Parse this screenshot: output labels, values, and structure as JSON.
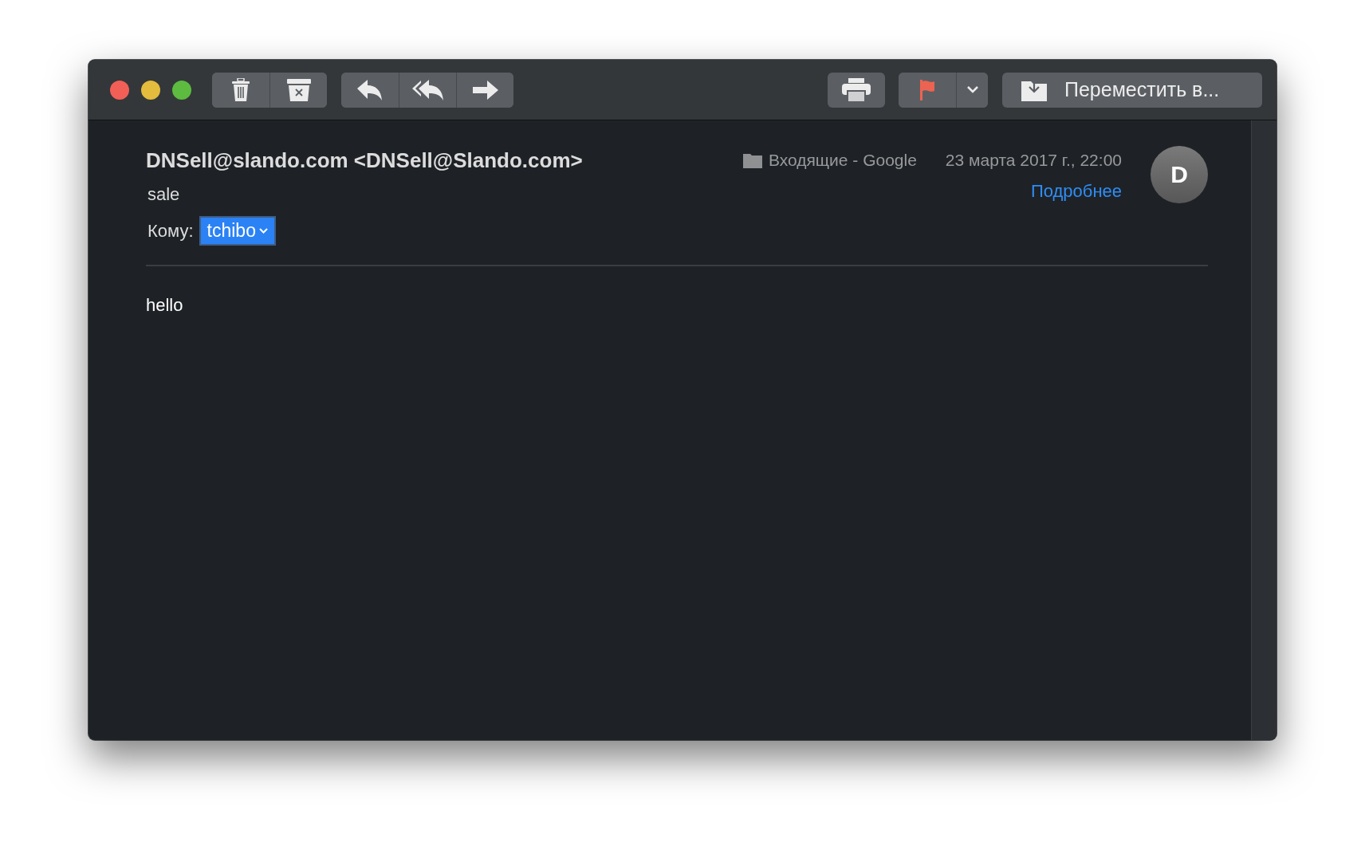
{
  "toolbar": {
    "move_button": {
      "label": "Переместить в..."
    }
  },
  "message": {
    "sender": "DNSell@slando.com <DNSell@Slando.com>",
    "subject": "sale",
    "to_label": "Кому:",
    "recipient": "tchibo",
    "folder": "Входящие - Google",
    "date": "23 марта 2017 г., 22:00",
    "details_link": "Подробнее",
    "avatar": "D",
    "body": "hello"
  }
}
